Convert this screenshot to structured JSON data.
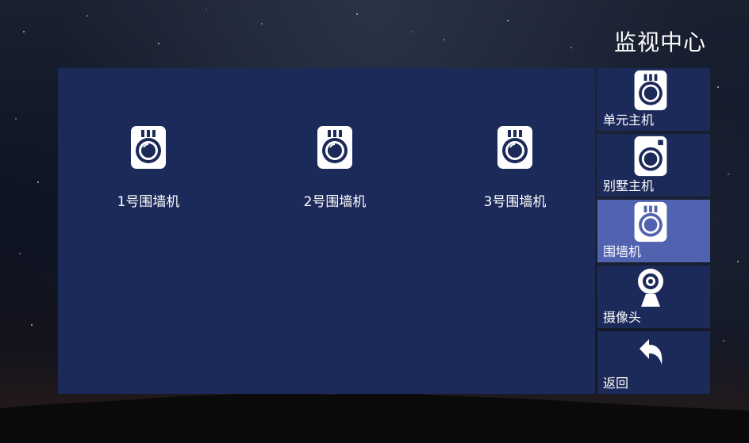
{
  "header": {
    "title": "监视中心"
  },
  "devices": [
    {
      "label": "1号围墙机",
      "icon": "wall-station-camera-icon"
    },
    {
      "label": "2号围墙机",
      "icon": "wall-station-camera-icon"
    },
    {
      "label": "3号围墙机",
      "icon": "wall-station-camera-icon"
    }
  ],
  "sidebar": {
    "items": [
      {
        "label": "单元主机",
        "icon": "unit-station-camera-icon",
        "active": false
      },
      {
        "label": "别墅主机",
        "icon": "villa-station-camera-icon",
        "active": false
      },
      {
        "label": "围墙机",
        "icon": "wall-station-camera-icon",
        "active": true
      },
      {
        "label": "摄像头",
        "icon": "webcam-icon",
        "active": false
      },
      {
        "label": "返回",
        "icon": "back-arrow-icon",
        "active": false
      }
    ]
  },
  "colors": {
    "panel": "#1c2a5a",
    "active_item": "#5062b0",
    "text": "#ffffff"
  }
}
